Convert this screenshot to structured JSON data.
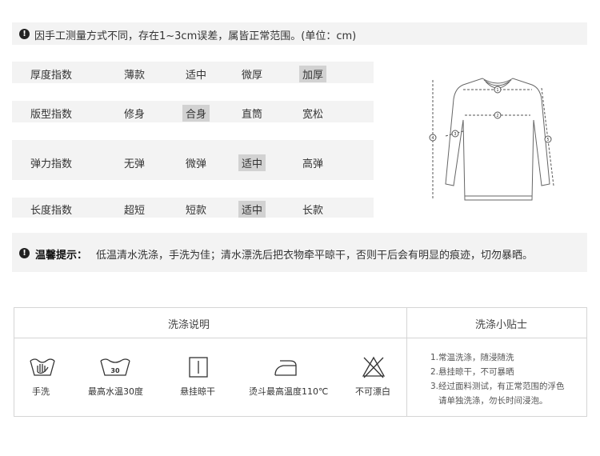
{
  "notice": {
    "text": "因手工测量方式不同，存在1~3cm误差，属皆正常范围。(单位：cm)"
  },
  "indices": [
    {
      "label": "厚度指数",
      "options": [
        "薄款",
        "适中",
        "微厚",
        "加厚"
      ],
      "selected": "加厚"
    },
    {
      "label": "版型指数",
      "options": [
        "修身",
        "合身",
        "直筒",
        "宽松"
      ],
      "selected": "合身"
    },
    {
      "label": "弹力指数",
      "options": [
        "无弹",
        "微弹",
        "适中",
        "高弹"
      ],
      "selected": "适中"
    },
    {
      "label": "长度指数",
      "options": [
        "超短",
        "短款",
        "适中",
        "长款"
      ],
      "selected": "适中"
    }
  ],
  "diagram": {
    "labels": [
      "1",
      "2",
      "3",
      "4",
      "5"
    ]
  },
  "warm_tip": {
    "title": "温馨提示：",
    "text": "低温清水洗涤，手洗为佳；清水漂洗后把衣物牵平晾干，否则干后会有明显的痕迹，切勿暴晒。"
  },
  "washing": {
    "header": "洗涤说明",
    "tips_header": "洗涤小贴士",
    "temp_value": "30",
    "symbols": [
      {
        "icon": "hand-wash-icon",
        "label": "手洗"
      },
      {
        "icon": "max-wash-temp-30-icon",
        "label": "最高水温30度"
      },
      {
        "icon": "hang-dry-icon",
        "label": "悬挂晾干"
      },
      {
        "icon": "iron-icon",
        "label": "烫斗最高温度110℃"
      },
      {
        "icon": "no-bleach-icon",
        "label": "不可漂白"
      }
    ],
    "tips": [
      "1.常温洗涤，随浸随洗",
      "2.悬挂晾干，不可暴晒",
      "3.经过面料测试，有正常范围的浮色",
      "请单独洗涤，勿长时间浸泡。"
    ]
  }
}
